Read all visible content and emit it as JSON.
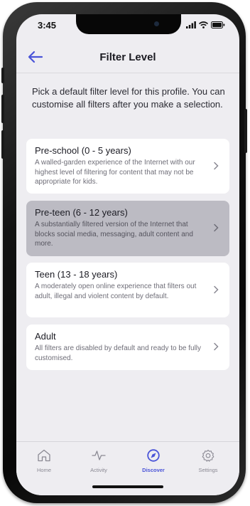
{
  "status_bar": {
    "time": "3:45"
  },
  "header": {
    "title": "Filter Level",
    "back_icon": "arrow-left-icon"
  },
  "intro_text": "Pick a default filter level for this profile. You can customise all filters after you make a selection.",
  "options": [
    {
      "title": "Pre-school (0 - 5 years)",
      "description": "A walled-garden experience of the Internet with our highest level of filtering for content that may not be appropriate for kids.",
      "selected": false
    },
    {
      "title": "Pre-teen (6 - 12 years)",
      "description": "A substantially filtered version of the Internet that blocks social media, messaging, adult content and more.",
      "selected": true
    },
    {
      "title": "Teen (13 - 18 years)",
      "description": "A moderately open online experience that filters out adult, illegal and violent content by default.",
      "selected": false
    },
    {
      "title": "Adult",
      "description": "All filters are disabled by default and ready to be fully customised.",
      "selected": false
    }
  ],
  "tabbar": {
    "items": [
      {
        "label": "Home",
        "icon": "home-icon",
        "active": false
      },
      {
        "label": "Activity",
        "icon": "activity-icon",
        "active": false
      },
      {
        "label": "Discover",
        "icon": "compass-icon",
        "active": true
      },
      {
        "label": "Settings",
        "icon": "gear-icon",
        "active": false
      }
    ]
  },
  "colors": {
    "accent": "#4a54d8",
    "background": "#eeedf1",
    "card": "#ffffff",
    "card_selected": "#bcbbc3"
  }
}
